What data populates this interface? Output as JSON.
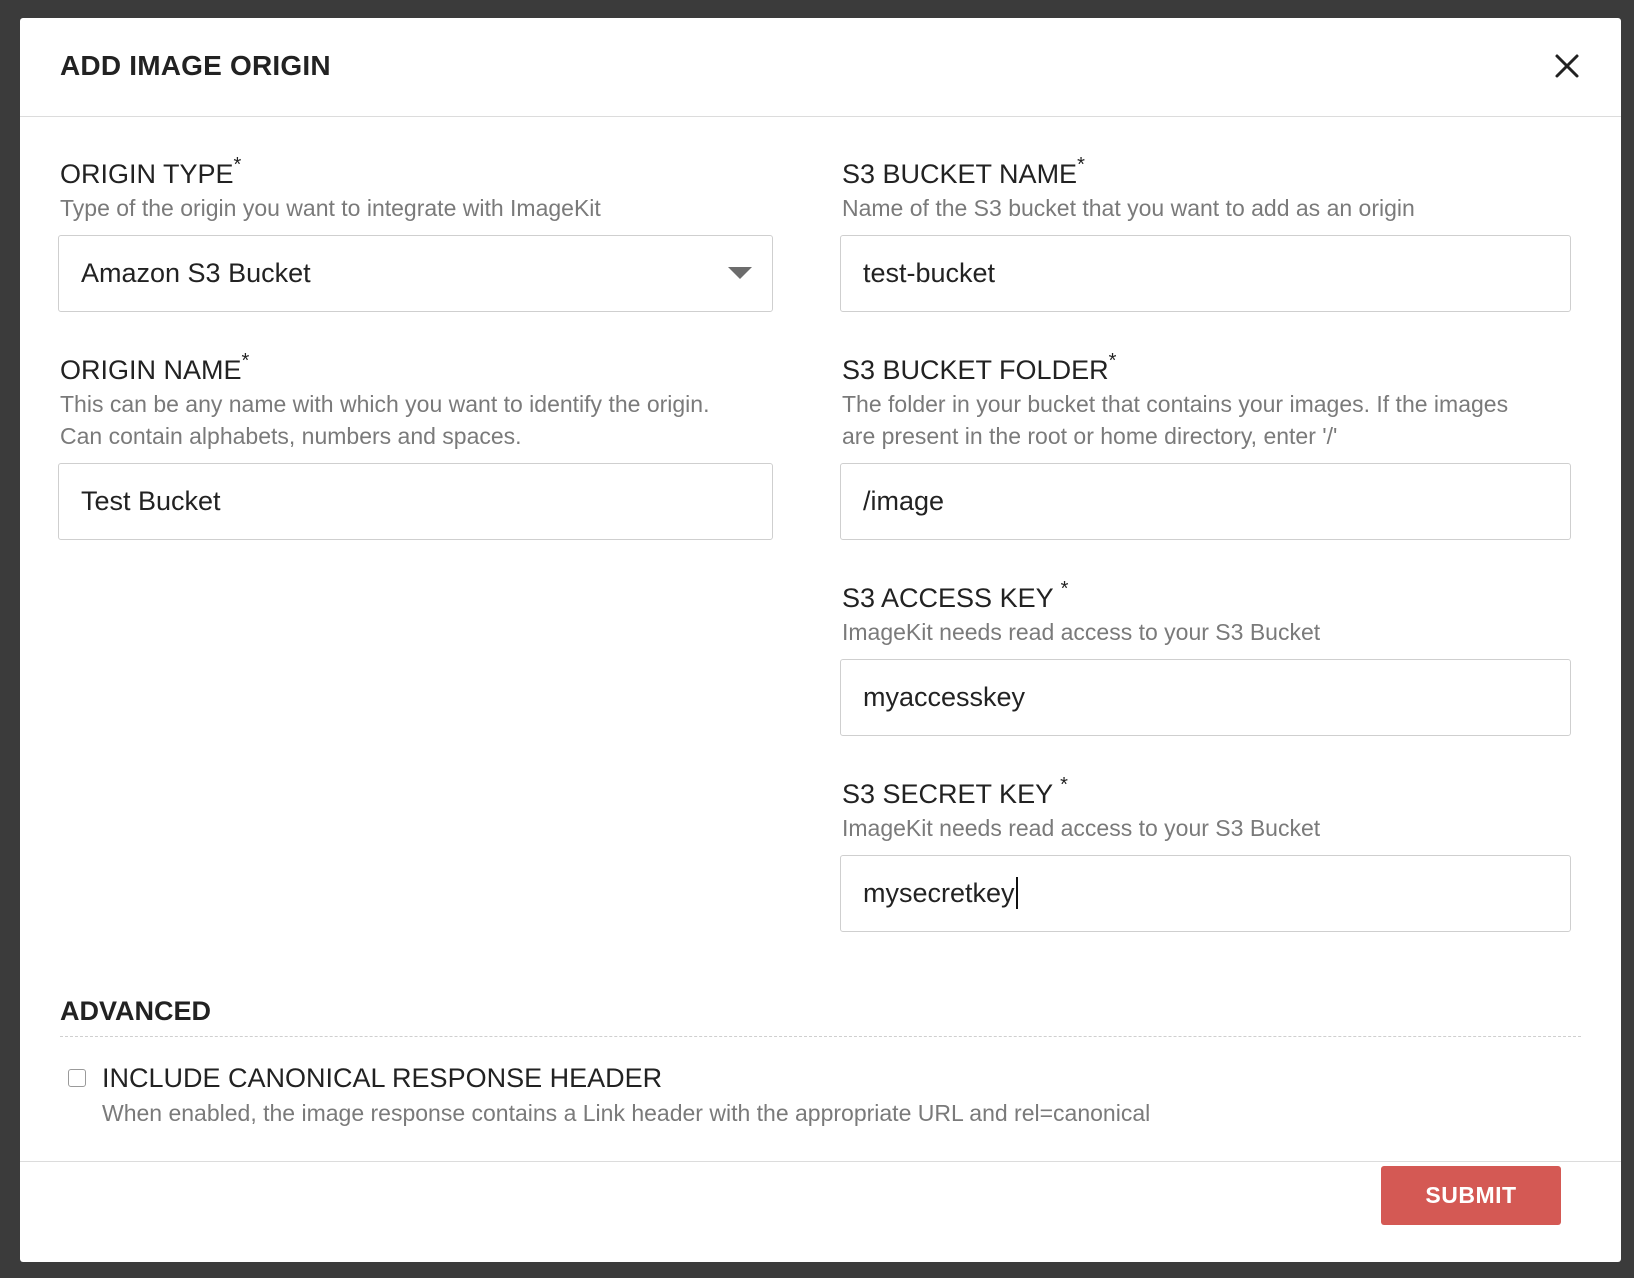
{
  "modal": {
    "title": "ADD IMAGE ORIGIN",
    "close_icon": "close-icon"
  },
  "left": {
    "origin_type": {
      "label": "ORIGIN TYPE",
      "required": "*",
      "help": "Type of the origin you want to integrate with ImageKit",
      "value": "Amazon S3 Bucket"
    },
    "origin_name": {
      "label": "ORIGIN NAME",
      "required": "*",
      "help_line1": "This can be any name with which you want to identify the origin.",
      "help_line2": "Can contain alphabets, numbers and spaces.",
      "value": "Test Bucket"
    }
  },
  "right": {
    "bucket_name": {
      "label": "S3 BUCKET NAME",
      "required": "*",
      "help": "Name of the S3 bucket that you want to add as an origin",
      "value": "test-bucket"
    },
    "bucket_folder": {
      "label": "S3 BUCKET FOLDER",
      "required": "*",
      "help_line1": "The folder in your bucket that contains your images. If the images",
      "help_line2": "are present in the root or home directory, enter '/'",
      "value": "/image"
    },
    "access_key": {
      "label": "S3 ACCESS KEY ",
      "required": "*",
      "help": "ImageKit needs read access to your S3 Bucket",
      "value": "myaccesskey"
    },
    "secret_key": {
      "label": "S3 SECRET KEY ",
      "required": "*",
      "help": "ImageKit needs read access to your S3 Bucket",
      "value": "mysecretkey"
    }
  },
  "advanced": {
    "title": "ADVANCED",
    "canonical": {
      "label": "INCLUDE CANONICAL RESPONSE HEADER",
      "help": "When enabled, the image response contains a Link header with the appropriate URL and rel=canonical",
      "checked": false
    }
  },
  "footer": {
    "submit_label": "SUBMIT",
    "submit_color": "#d45954"
  }
}
